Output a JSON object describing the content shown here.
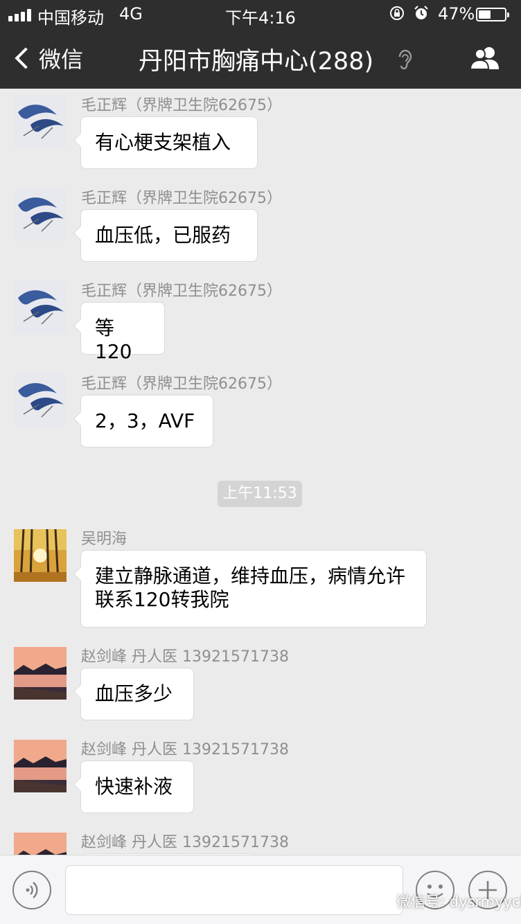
{
  "status_bar": {
    "carrier": "中国移动",
    "network": "4G",
    "time": "下午4:16",
    "battery_percent_text": "47%",
    "battery_level": 0.47
  },
  "nav": {
    "back_label": "微信",
    "title": "丹阳市胸痛中心(288)",
    "icons": [
      "chevron-left-icon",
      "ear-icon",
      "group-contacts-icon"
    ]
  },
  "messages": [
    {
      "sender": "毛正辉（界牌卫生院62675）",
      "text": "有心梗支架植入",
      "avatar": "fish-painting"
    },
    {
      "sender": "毛正辉（界牌卫生院62675）",
      "text": "血压低，已服药",
      "avatar": "fish-painting"
    },
    {
      "sender": "毛正辉（界牌卫生院62675）",
      "text": "等120",
      "avatar": "fish-painting"
    },
    {
      "sender": "毛正辉（界牌卫生院62675）",
      "text": "2，3，AVF",
      "avatar": "fish-painting"
    },
    {
      "sender": "吴明海",
      "text": "建立静脉通道，维持血压，病情允许联系120转我院",
      "avatar": "autumn-trees"
    },
    {
      "sender": "赵剑峰 丹人医 13921571738",
      "text": "血压多少",
      "avatar": "sunset-lake"
    },
    {
      "sender": "赵剑峰 丹人医 13921571738",
      "text": "快速补液",
      "avatar": "sunset-lake"
    },
    {
      "sender": "赵剑峰 丹人医 13921571738",
      "text": "",
      "avatar": "sunset-lake"
    }
  ],
  "time_separator": "上午11:53",
  "input_bar": {
    "placeholder": "",
    "icons": [
      "voice-icon",
      "emoji-icon",
      "plus-icon"
    ]
  },
  "watermark": "微信号: dysrmyyck",
  "colors": {
    "header_bg": "#2e2e2e",
    "chat_bg": "#ebebeb",
    "bubble_bg": "#ffffff",
    "sender_text": "#8f8f8f",
    "time_separator_bg": "#d4d4d4"
  }
}
